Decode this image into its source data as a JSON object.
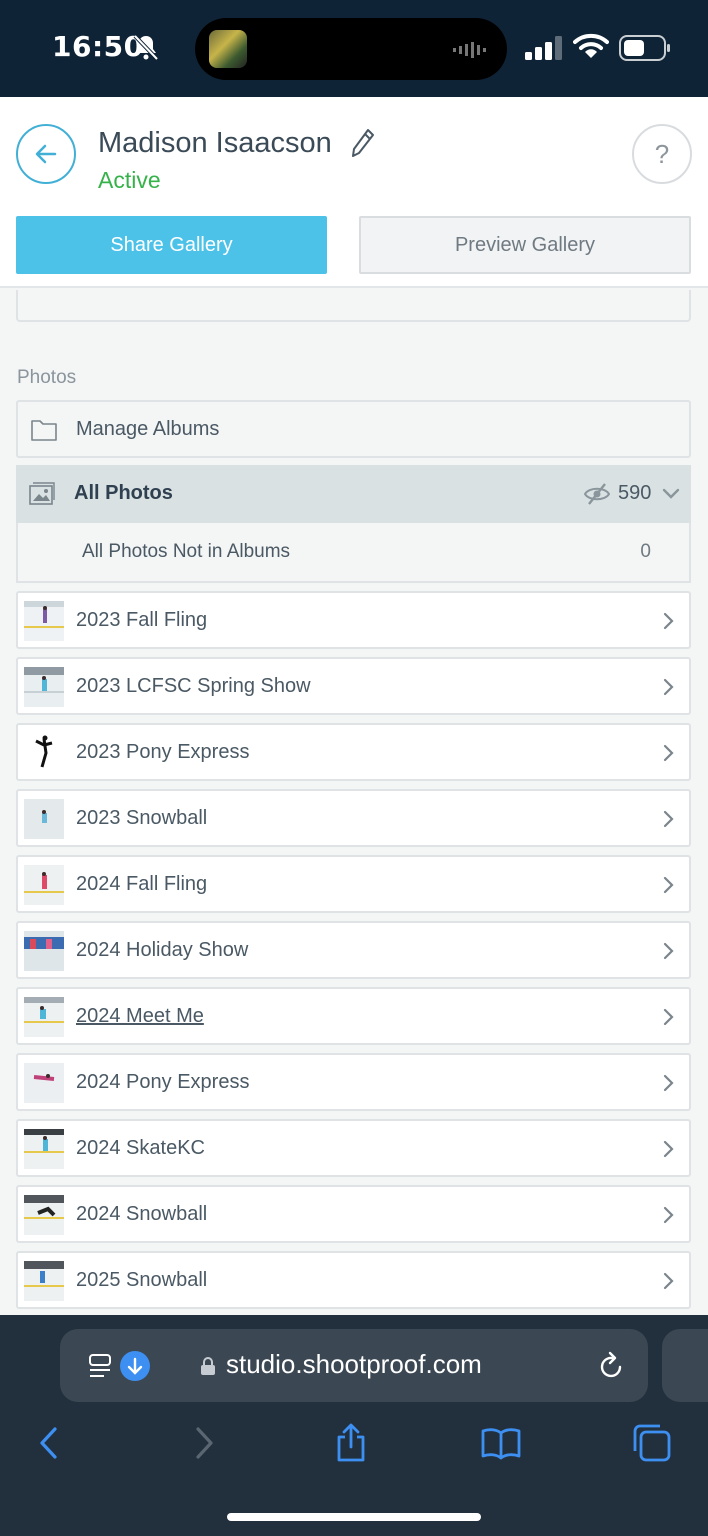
{
  "status_bar": {
    "time": "16:50"
  },
  "header": {
    "name": "Madison Isaacson",
    "status": "Active",
    "help": "?",
    "share_label": "Share Gallery",
    "preview_label": "Preview Gallery"
  },
  "photos": {
    "section_label": "Photos",
    "manage_label": "Manage Albums",
    "all_photos_label": "All Photos",
    "all_photos_count": "590",
    "not_in_albums_label": "All Photos Not in Albums",
    "not_in_albums_count": "0"
  },
  "albums": [
    {
      "label": "2023 Fall Fling"
    },
    {
      "label": "2023 LCFSC Spring Show"
    },
    {
      "label": "2023 Pony Express"
    },
    {
      "label": "2023 Snowball"
    },
    {
      "label": "2024 Fall Fling"
    },
    {
      "label": "2024 Holiday Show"
    },
    {
      "label": "2024 Meet Me"
    },
    {
      "label": "2024 Pony Express"
    },
    {
      "label": "2024 SkateKC"
    },
    {
      "label": "2024 Snowball"
    },
    {
      "label": "2025 Snowball"
    }
  ],
  "browser": {
    "url": "studio.shootproof.com"
  },
  "colors": {
    "accent": "#4cc2e8",
    "active": "#36b24a",
    "browser_bg": "#22303d"
  }
}
